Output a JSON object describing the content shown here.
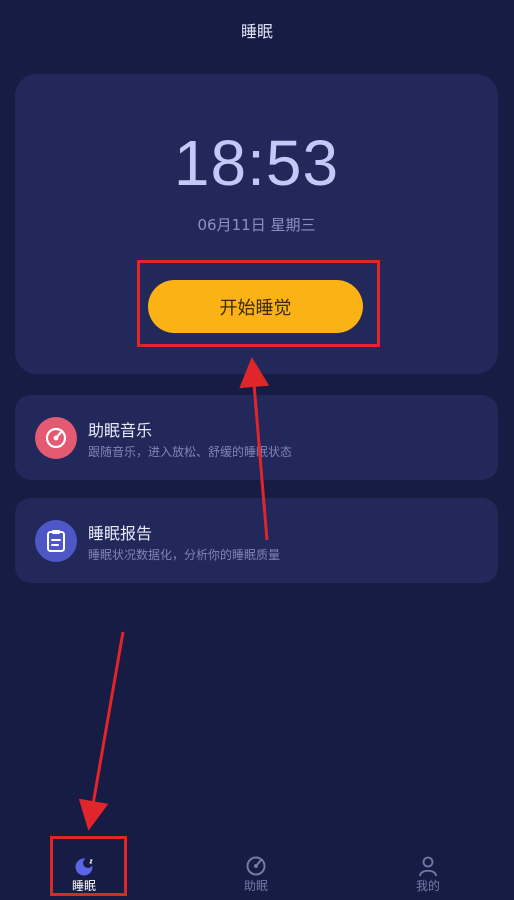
{
  "header": {
    "title": "睡眠"
  },
  "clock": {
    "time": "18:53",
    "date": "06月11日 星期三",
    "start_button_label": "开始睡觉"
  },
  "features": [
    {
      "title": "助眠音乐",
      "description": "跟随音乐，进入放松、舒缓的睡眠状态",
      "icon": "music-disc-icon",
      "color": "#e35a72"
    },
    {
      "title": "睡眠报告",
      "description": "睡眠状况数据化，分析你的睡眠质量",
      "icon": "clipboard-icon",
      "color": "#4f57c7"
    }
  ],
  "tabs": [
    {
      "label": "睡眠",
      "icon": "moon-icon",
      "active": true
    },
    {
      "label": "助眠",
      "icon": "music-disc-icon",
      "active": false
    },
    {
      "label": "我的",
      "icon": "person-icon",
      "active": false
    }
  ],
  "colors": {
    "background": "#171c45",
    "card": "#222859",
    "accent": "#fbb215",
    "annotation": "#e0252b"
  }
}
